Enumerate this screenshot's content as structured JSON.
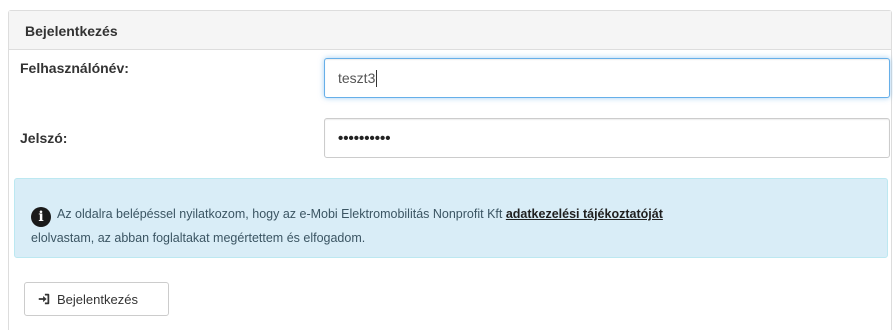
{
  "panel": {
    "title": "Bejelentkezés"
  },
  "form": {
    "username_label": "Felhasználónév:",
    "username_value": "teszt3",
    "password_label": "Jelszó:",
    "password_masked": "••••••••••"
  },
  "notice": {
    "icon": "info-circle-icon",
    "text_before": "Az oldalra belépéssel nyilatkozom, hogy az e-Mobi Elektromobilitás Nonprofit Kft",
    "link_text": "adatkezelési tájékoztatóját",
    "text_after": "elolvastam, az abban foglaltakat megértettem és elfogadom."
  },
  "actions": {
    "login_button_label": "Bejelentkezés",
    "login_button_icon": "sign-in-icon"
  },
  "colors": {
    "alert_background": "#d9edf7",
    "input_focus_border": "#66afe9"
  }
}
